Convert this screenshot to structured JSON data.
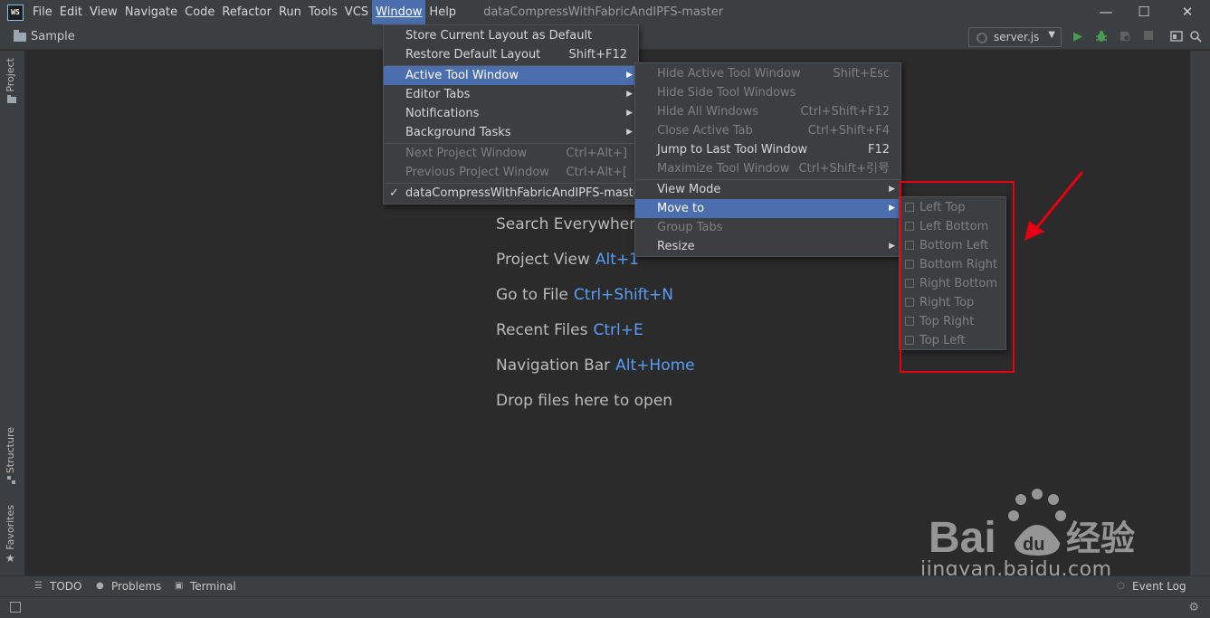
{
  "app": {
    "logo_text": "WS",
    "window_title": "dataCompressWithFabricAndIPFS-master"
  },
  "menubar": {
    "items": [
      {
        "label": "File"
      },
      {
        "label": "Edit"
      },
      {
        "label": "View"
      },
      {
        "label": "Navigate"
      },
      {
        "label": "Code"
      },
      {
        "label": "Refactor"
      },
      {
        "label": "Run"
      },
      {
        "label": "Tools"
      },
      {
        "label": "VCS"
      },
      {
        "label": "Window"
      },
      {
        "label": "Help"
      }
    ],
    "active": "Window"
  },
  "window_controls": {
    "minimize": "—",
    "maximize": "☐",
    "close": "✕"
  },
  "navbar": {
    "project": "Sample",
    "run_config": "server.js",
    "icons": [
      "run-icon",
      "debug-icon",
      "coverage-icon",
      "stop-icon",
      "project-structure-icon",
      "search-everywhere-icon"
    ]
  },
  "side_tabs": {
    "project": "Project",
    "structure": "Structure",
    "favorites": "Favorites"
  },
  "editor": {
    "hints": [
      {
        "text": "Search Everywhere",
        "shortcut": ""
      },
      {
        "text": "Project View",
        "shortcut": "Alt+1"
      },
      {
        "text": "Go to File",
        "shortcut": "Ctrl+Shift+N"
      },
      {
        "text": "Recent Files",
        "shortcut": "Ctrl+E"
      },
      {
        "text": "Navigation Bar",
        "shortcut": "Alt+Home"
      },
      {
        "text": "Drop files here to open",
        "shortcut": ""
      }
    ]
  },
  "window_menu": {
    "items": [
      {
        "label": "Store Current Layout as Default",
        "shortcut": ""
      },
      {
        "label": "Restore Default Layout",
        "shortcut": "Shift+F12"
      },
      {
        "label": "Active Tool Window",
        "shortcut": "",
        "submenu": true,
        "highlighted": true
      },
      {
        "label": "Editor Tabs",
        "shortcut": "",
        "submenu": true
      },
      {
        "label": "Notifications",
        "shortcut": "",
        "submenu": true
      },
      {
        "label": "Background Tasks",
        "shortcut": "",
        "submenu": true
      },
      {
        "label": "Next Project Window",
        "shortcut": "Ctrl+Alt+]",
        "disabled": true
      },
      {
        "label": "Previous Project Window",
        "shortcut": "Ctrl+Alt+[",
        "disabled": true
      },
      {
        "label": "dataCompressWithFabricAndIPFS-master",
        "shortcut": "",
        "checked": true
      }
    ]
  },
  "active_tool_window_menu": {
    "items": [
      {
        "label": "Hide Active Tool Window",
        "shortcut": "Shift+Esc",
        "disabled": true
      },
      {
        "label": "Hide Side Tool Windows",
        "shortcut": "",
        "disabled": true
      },
      {
        "label": "Hide All Windows",
        "shortcut": "Ctrl+Shift+F12",
        "disabled": true
      },
      {
        "label": "Close Active Tab",
        "shortcut": "Ctrl+Shift+F4",
        "disabled": true
      },
      {
        "label": "Jump to Last Tool Window",
        "shortcut": "F12"
      },
      {
        "label": "Maximize Tool Window",
        "shortcut": "Ctrl+Shift+引号",
        "disabled": true
      },
      {
        "label": "View Mode",
        "submenu": true
      },
      {
        "label": "Move to",
        "submenu": true,
        "highlighted": true
      },
      {
        "label": "Group Tabs",
        "disabled": true
      },
      {
        "label": "Resize",
        "submenu": true
      }
    ]
  },
  "move_to_menu": {
    "items": [
      "Left Top",
      "Left Bottom",
      "Bottom Left",
      "Bottom Right",
      "Right Bottom",
      "Right Top",
      "Top Right",
      "Top Left"
    ]
  },
  "bottom_tabs": [
    {
      "label": "TODO",
      "icon": "todo-icon"
    },
    {
      "label": "Problems",
      "icon": "problems-icon"
    },
    {
      "label": "Terminal",
      "icon": "terminal-icon"
    },
    {
      "label": "Event Log",
      "icon": "event-log-icon"
    }
  ],
  "annotation_color": "#e60012",
  "watermark": {
    "brand": "Bai du 经验",
    "url": "jingyan.baidu.com"
  },
  "colors": {
    "accent": "#4b6eaf",
    "shortcut": "#589df6",
    "background": "#2b2b2b",
    "chrome": "#3c3f41"
  }
}
